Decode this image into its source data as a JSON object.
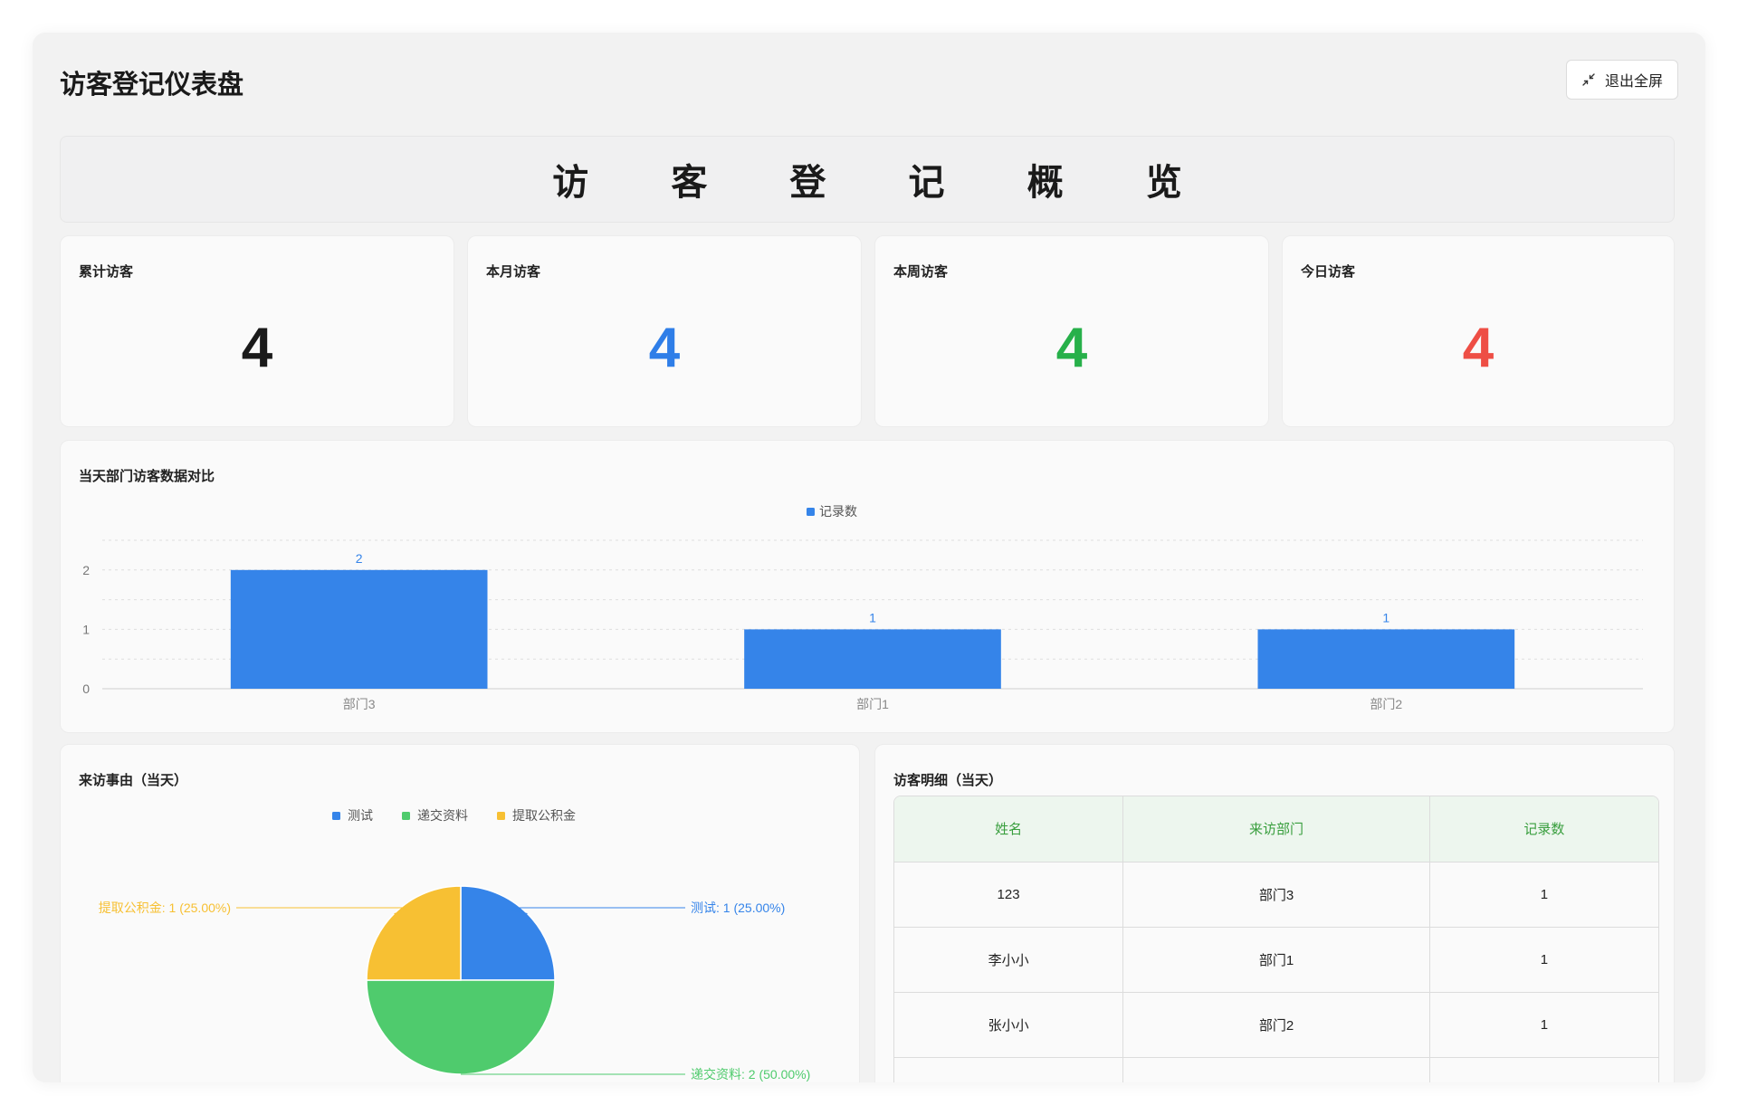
{
  "header": {
    "title": "访客登记仪表盘",
    "exit_fullscreen_label": "退出全屏"
  },
  "banner": {
    "text": "访 客 登 记 概 览"
  },
  "stats": [
    {
      "label": "累计访客",
      "value": "4",
      "color": "#1a1a1a"
    },
    {
      "label": "本月访客",
      "value": "4",
      "color": "#2f7ee8"
    },
    {
      "label": "本周访客",
      "value": "4",
      "color": "#27b04a"
    },
    {
      "label": "今日访客",
      "value": "4",
      "color": "#ee4e45"
    }
  ],
  "bar_panel": {
    "title": "当天部门访客数据对比"
  },
  "pie_panel": {
    "title": "来访事由（当天）"
  },
  "table_panel": {
    "title": "访客明细（当天）",
    "columns": [
      "姓名",
      "来访部门",
      "记录数"
    ],
    "rows": [
      [
        "123",
        "部门3",
        "1"
      ],
      [
        "李小小",
        "部门1",
        "1"
      ],
      [
        "张小小",
        "部门2",
        "1"
      ]
    ]
  },
  "chart_data": [
    {
      "type": "bar",
      "categories": [
        "部门3",
        "部门1",
        "部门2"
      ],
      "series": [
        {
          "name": "记录数",
          "values": [
            2,
            1,
            1
          ],
          "color": "#3584e9"
        }
      ],
      "ylim": [
        0,
        2.5
      ],
      "yticks": [
        0,
        1,
        2
      ],
      "grid": true,
      "legend": "top-center",
      "data_labels": true
    },
    {
      "type": "pie",
      "slices": [
        {
          "name": "测试",
          "value": 1,
          "percent": "25.00%",
          "color": "#3584e9",
          "label": "测试: 1 (25.00%)"
        },
        {
          "name": "递交资料",
          "value": 2,
          "percent": "50.00%",
          "color": "#4fcb6d",
          "label": "递交资料: 2 (50.00%)"
        },
        {
          "name": "提取公积金",
          "value": 1,
          "percent": "25.00%",
          "color": "#f7c033",
          "label": "提取公积金: 1 (25.00%)"
        }
      ],
      "legend": "top-center"
    }
  ]
}
